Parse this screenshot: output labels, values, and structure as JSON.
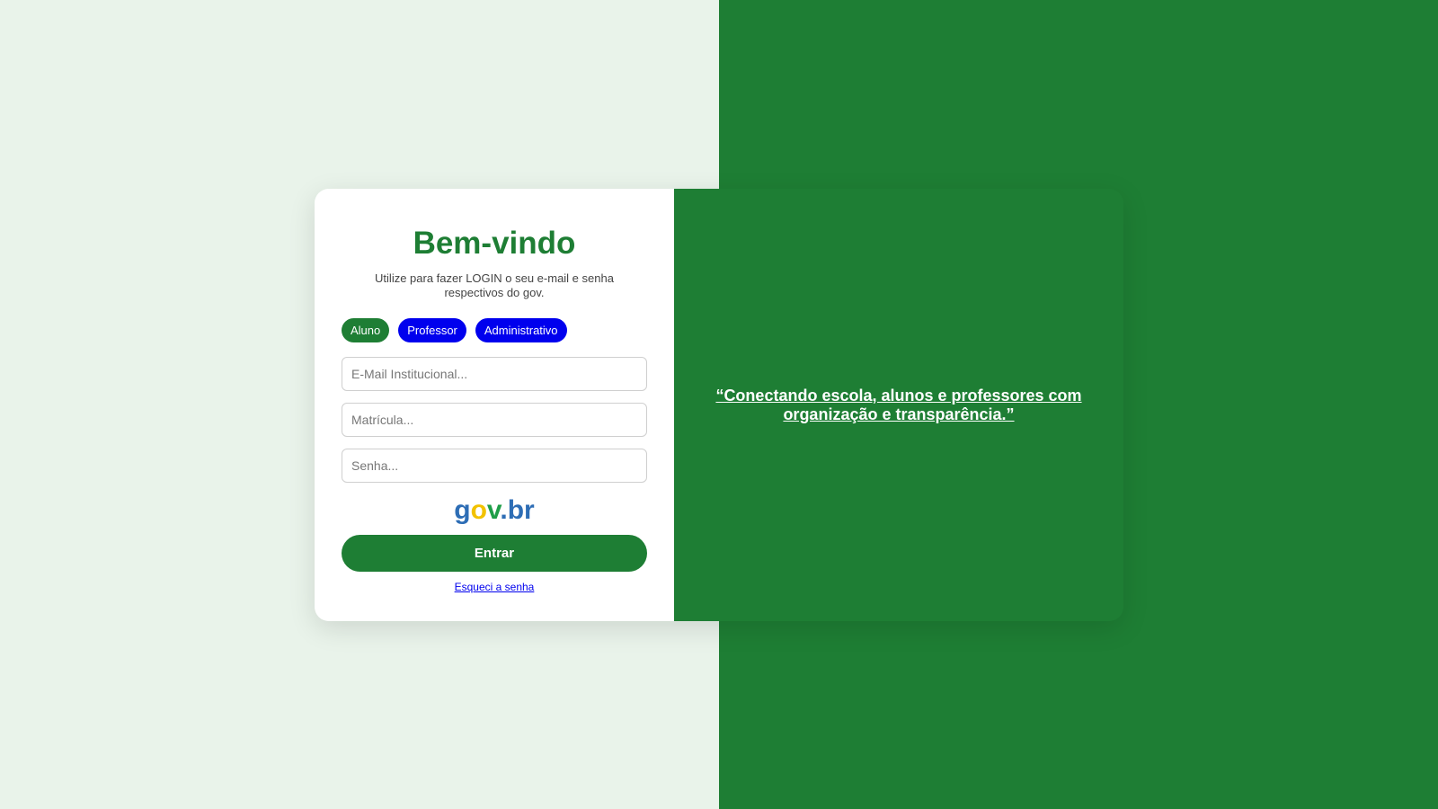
{
  "login": {
    "title": "Bem-vindo",
    "subtitle": "Utilize para fazer LOGIN o seu e-mail e senha respectivos do gov.",
    "roles": [
      {
        "label": "Aluno",
        "active": true
      },
      {
        "label": "Professor",
        "active": false
      },
      {
        "label": "Administrativo",
        "active": false
      }
    ],
    "fields": {
      "email_placeholder": "E-Mail Institucional...",
      "matricula_placeholder": "Matrícula...",
      "senha_placeholder": "Senha..."
    },
    "gov_logo": {
      "g": "g",
      "o": "o",
      "v": "v",
      "dot": ".",
      "br": "br"
    },
    "submit_label": "Entrar",
    "forgot_label": "Esqueci a senha"
  },
  "banner": {
    "quote": "“Conectando escola, alunos e professores com organização e transparência.”"
  },
  "colors": {
    "primary_green": "#1e7e34",
    "role_blue": "#0000ee",
    "page_bg_left": "#e9f3ea",
    "card_bg": "#ffffff"
  }
}
